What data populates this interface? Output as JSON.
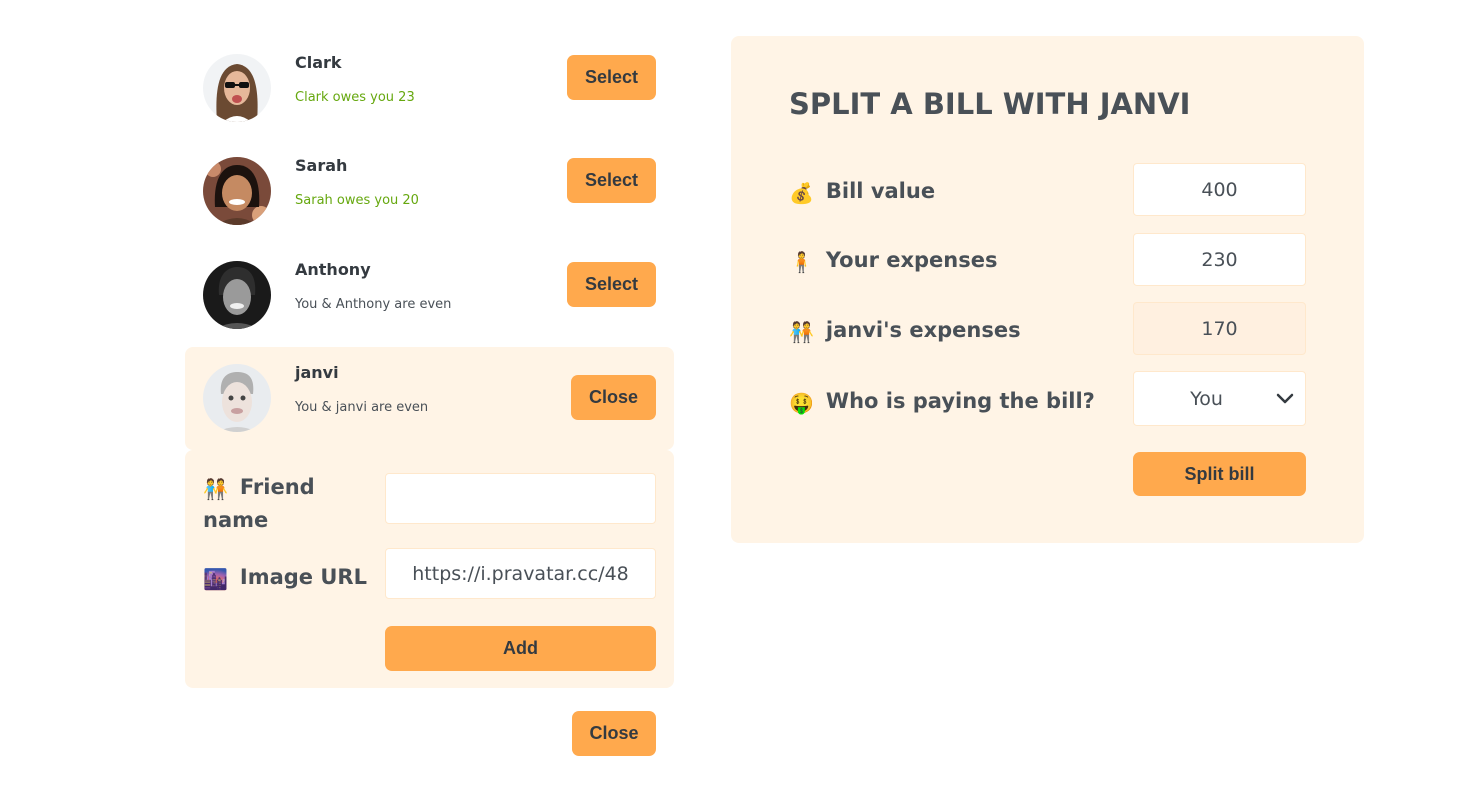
{
  "friends": [
    {
      "name": "Clark",
      "status": "Clark owes you 23",
      "status_tone": "positive",
      "button": "Select",
      "selected": false
    },
    {
      "name": "Sarah",
      "status": "Sarah owes you 20",
      "status_tone": "positive",
      "button": "Select",
      "selected": false
    },
    {
      "name": "Anthony",
      "status": "You & Anthony are even",
      "status_tone": "even",
      "button": "Select",
      "selected": false
    },
    {
      "name": "janvi",
      "status": "You & janvi are even",
      "status_tone": "even",
      "button": "Close",
      "selected": true
    }
  ],
  "add_friend_form": {
    "friend_name_icon": "people-holding-hands-icon",
    "friend_name_label": "Friend name",
    "friend_name_value": "",
    "image_url_icon": "cityscape-at-dusk-icon",
    "image_url_label": "Image URL",
    "image_url_value": "https://i.pravatar.cc/48",
    "add_button": "Add"
  },
  "close_form_button": "Close",
  "split_form": {
    "title": "SPLIT A BILL WITH JANVI",
    "bill_value_icon": "money-bag-icon",
    "bill_value_label": "Bill value",
    "bill_value": "400",
    "your_expense_icon": "person-standing-icon",
    "your_expense_label": "Your expenses",
    "your_expense_value": "230",
    "friend_expense_icon": "people-holding-hands-icon",
    "friend_expense_label": "janvi's expenses",
    "friend_expense_value": "170",
    "payer_icon": "money-mouth-face-icon",
    "payer_label": "Who is paying the bill?",
    "payer_value": "You",
    "split_button": "Split bill"
  },
  "colors": {
    "accent": "#ffa94d",
    "panel_bg": "#fff4e6",
    "positive": "#66a80f",
    "text": "#495057"
  }
}
